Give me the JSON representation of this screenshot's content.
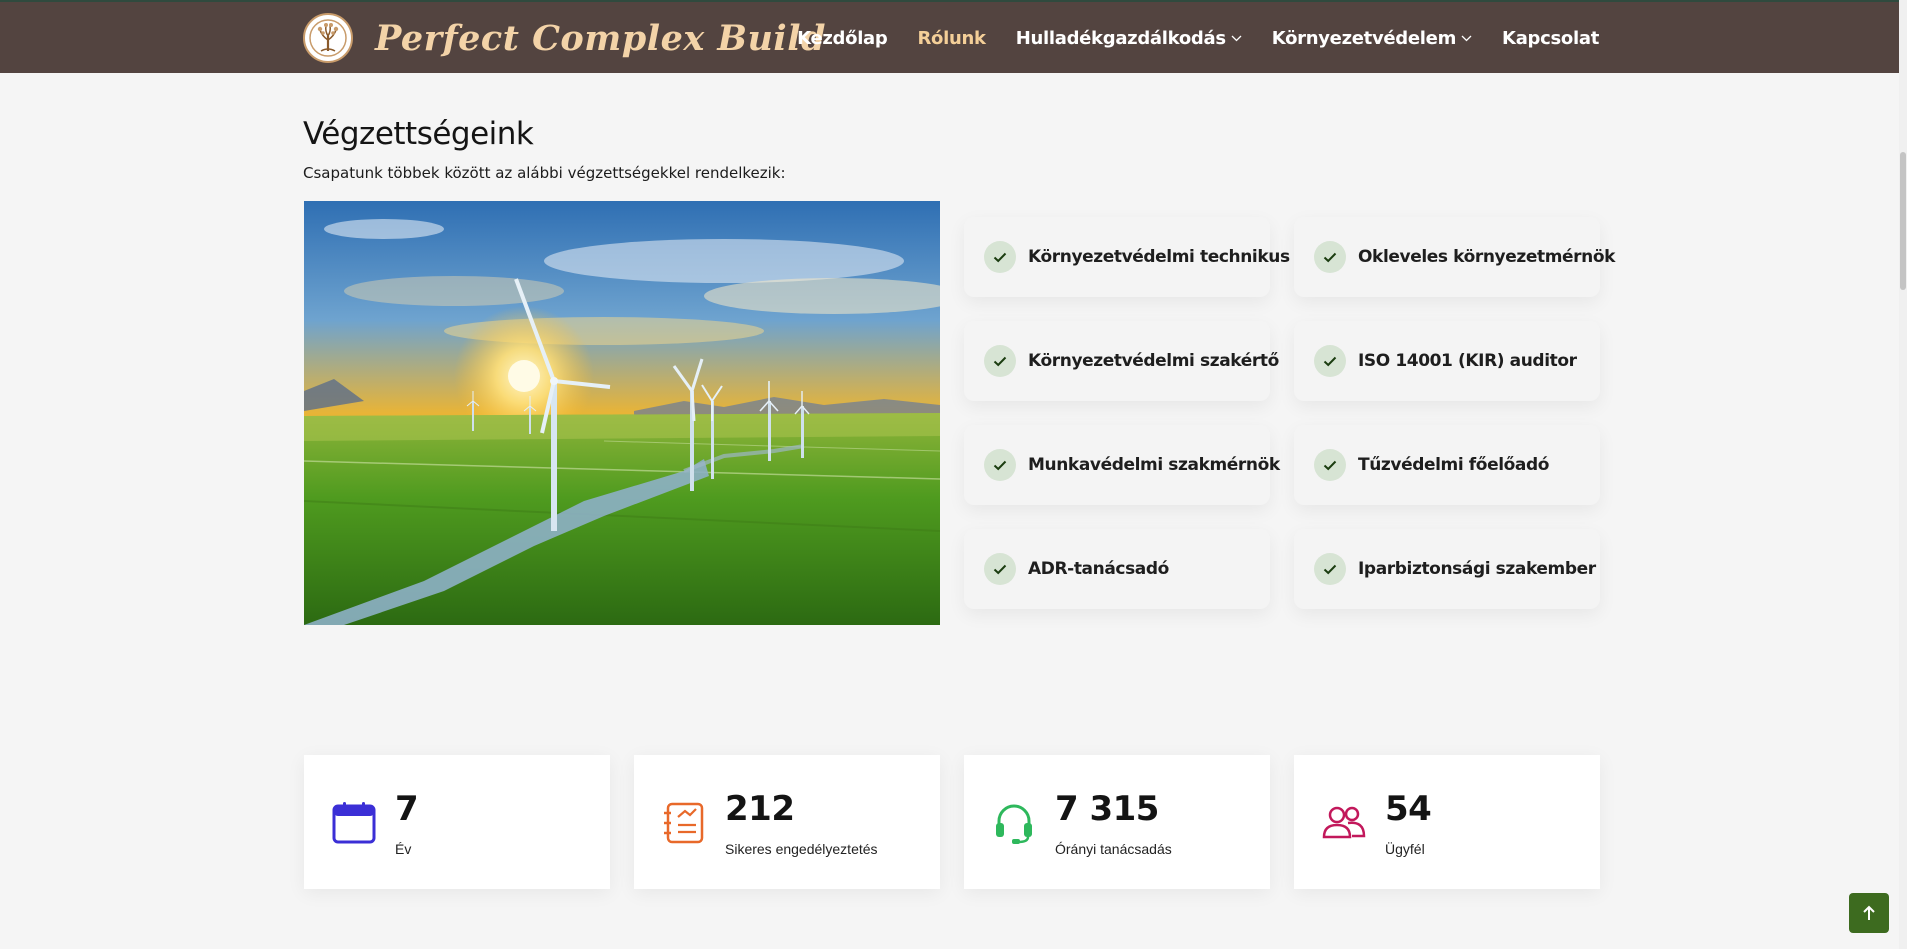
{
  "brand": {
    "name": "Perfect Complex Build",
    "accent": "#f4cf98",
    "header_bg": "#534440"
  },
  "nav": {
    "items": [
      {
        "label": "Kezdőlap",
        "active": false,
        "dropdown": false
      },
      {
        "label": "Rólunk",
        "active": true,
        "dropdown": false
      },
      {
        "label": "Hulladékgazdálkodás",
        "active": false,
        "dropdown": true
      },
      {
        "label": "Környezetvédelem",
        "active": false,
        "dropdown": true
      },
      {
        "label": "Kapcsolat",
        "active": false,
        "dropdown": false
      }
    ]
  },
  "section": {
    "title": "Végzettségeink",
    "subtitle": "Csapatunk többek között az alábbi végzettségekkel rendelkezik:"
  },
  "qualifications": [
    "Környezetvédelmi technikus",
    "Okleveles környezetmérnök",
    "Környezetvédelmi szakértő",
    "ISO 14001 (KIR) auditor",
    "Munkavédelmi szakmérnök",
    "Tűzvédelmi főelőadó",
    "ADR-tanácsadó",
    "Iparbiztonsági szakember"
  ],
  "stats": [
    {
      "value": "7",
      "label": "Év",
      "icon": "calendar-icon",
      "color": "#3b2fd6"
    },
    {
      "value": "212",
      "label": "Sikeres engedélyeztetés",
      "icon": "clipboard-icon",
      "color": "#e8692a"
    },
    {
      "value": "7 315",
      "label": "Órányi tanácsadás",
      "icon": "headset-icon",
      "color": "#2eb85c"
    },
    {
      "value": "54",
      "label": "Ügyfél",
      "icon": "users-icon",
      "color": "#c2185b"
    }
  ]
}
